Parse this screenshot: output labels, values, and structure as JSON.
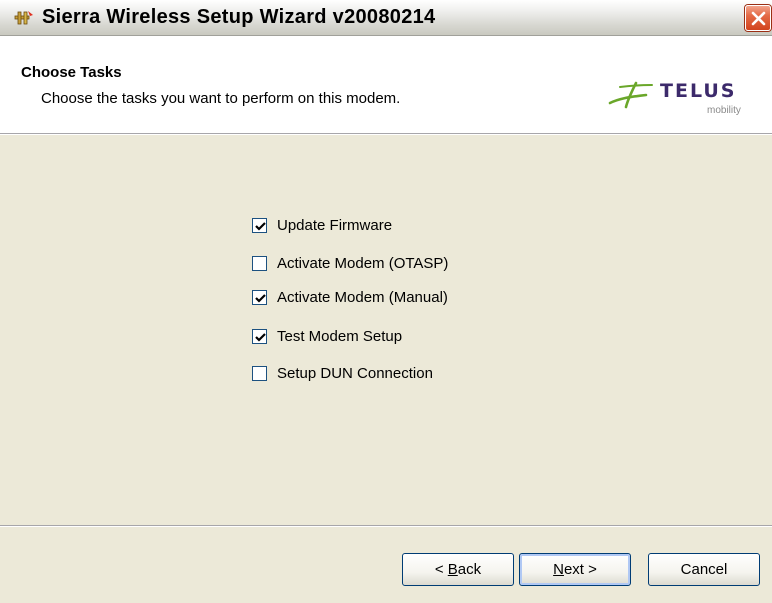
{
  "window": {
    "title": "Sierra Wireless Setup Wizard v20080214",
    "title_icon": "wizard-wand-icon",
    "close_icon": "close-icon"
  },
  "header": {
    "title": "Choose Tasks",
    "subtitle": "Choose the tasks you want to perform on this modem.",
    "logo": {
      "brand": "TELUS",
      "sub": "mobility"
    }
  },
  "tasks": [
    {
      "label": "Update Firmware",
      "checked": true
    },
    {
      "label": "Activate Modem (OTASP)",
      "checked": false
    },
    {
      "label": "Activate Modem (Manual)",
      "checked": true
    },
    {
      "label": "Test Modem Setup",
      "checked": true
    },
    {
      "label": "Setup DUN Connection",
      "checked": false
    }
  ],
  "buttons": {
    "back": {
      "accel": "B",
      "rest": "ack",
      "prefix": "< "
    },
    "next": {
      "accel": "N",
      "rest": "ext >",
      "prefix": ""
    },
    "cancel": {
      "label": "Cancel"
    }
  },
  "colors": {
    "dialog_bg": "#ece9d8",
    "close_red": "#d2431d",
    "telus_purple": "#3c2a6b",
    "telus_green": "#6aa72a"
  }
}
